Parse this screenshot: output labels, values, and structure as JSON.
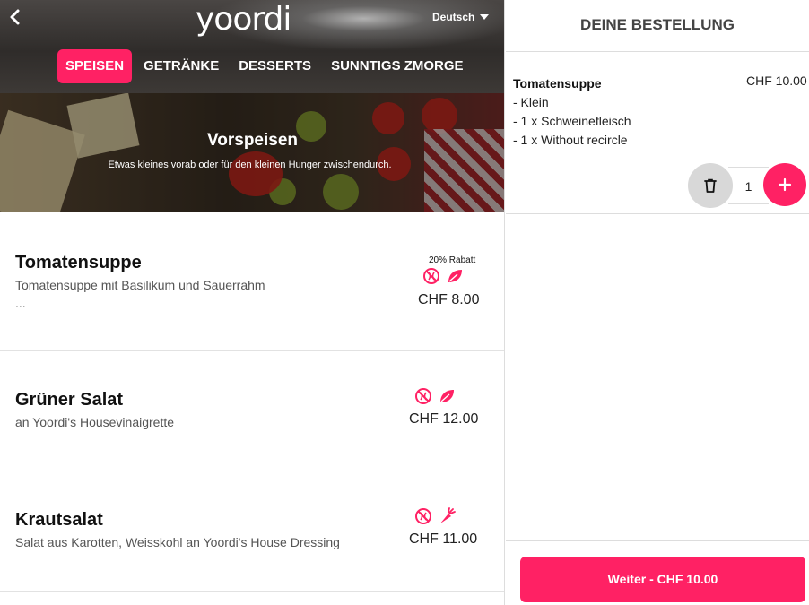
{
  "header": {
    "logo": "yoordi",
    "language": "Deutsch",
    "tabs": [
      {
        "label": "SPEISEN",
        "active": true
      },
      {
        "label": "GETRÄNKE",
        "active": false
      },
      {
        "label": "DESSERTS",
        "active": false
      },
      {
        "label": "SUNNTIGS ZMORGE",
        "active": false
      }
    ]
  },
  "category": {
    "title": "Vorspeisen",
    "subtitle": "Etwas kleines vorab oder für den kleinen Hunger zwischendurch."
  },
  "menu_items": [
    {
      "name": "Tomatensuppe",
      "description": "Tomatensuppe mit Basilikum und Sauerrahm",
      "more": "...",
      "discount": "20% Rabatt",
      "icons": [
        "no-gluten-icon",
        "leaf-icon"
      ],
      "price": "CHF 8.00"
    },
    {
      "name": "Grüner Salat",
      "description": "an Yoordi's Housevinaigrette",
      "icons": [
        "no-gluten-icon",
        "leaf-icon"
      ],
      "price": "CHF 12.00"
    },
    {
      "name": "Krautsalat",
      "description": "Salat aus Karotten, Weisskohl an Yoordi's House Dressing",
      "icons": [
        "no-gluten-icon",
        "carrot-icon"
      ],
      "price": "CHF 11.00"
    }
  ],
  "order": {
    "title": "DEINE BESTELLUNG",
    "items": [
      {
        "name": "Tomatensuppe",
        "price": "CHF 10.00",
        "options": [
          "- Klein",
          "- 1 x Schweinefleisch",
          "- 1 x Without recircle"
        ],
        "quantity": "1"
      }
    ],
    "cta_label": "Weiter - CHF 10.00"
  },
  "colors": {
    "accent": "#ff2164",
    "text": "#222222",
    "muted": "#555555",
    "divider": "#e2e2e2"
  }
}
